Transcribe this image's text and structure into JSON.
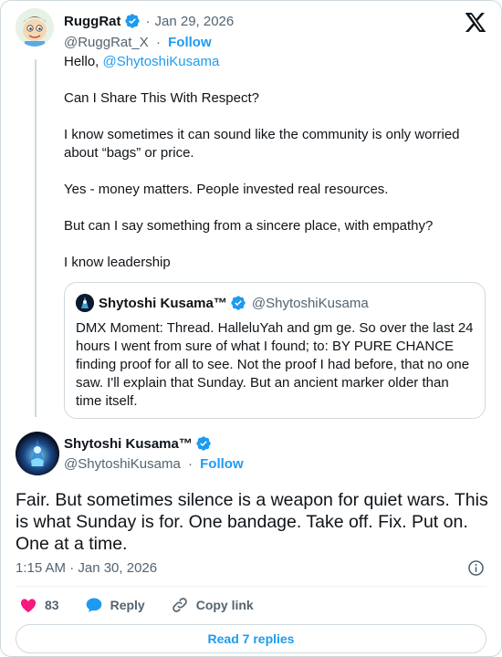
{
  "parent": {
    "name": "RuggRat",
    "handle": "@RuggRat_X",
    "sep1": "·",
    "date": "Jan 29, 2026",
    "sep2": "·",
    "follow": "Follow",
    "greeting_prefix": "Hello, ",
    "mention": "@ShytoshiKusama",
    "paragraphs": [
      "Can I Share This With Respect?",
      "I know sometimes it can sound like the community is only worried about “bags” or price.",
      "Yes - money matters. People invested real resources.",
      "But can I say something from a sincere place, with empathy?",
      "I know leadership"
    ]
  },
  "quote": {
    "name": "Shytoshi Kusama™",
    "handle": "@ShytoshiKusama",
    "text": "DMX Moment: Thread. HalleluYah and gm ge. So over the last 24 hours I went from sure of what I found; to: BY PURE CHANCE finding proof for all to see. Not the proof I had before, that no one saw. I'll explain that Sunday. But an ancient marker older than time itself."
  },
  "main": {
    "name": "Shytoshi Kusama™",
    "handle": "@ShytoshiKusama",
    "sep": "·",
    "follow": "Follow",
    "text": "Fair. But sometimes silence is a weapon for quiet wars. This is what Sunday is for. One bandage. Take off. Fix. Put on. One at a time.",
    "timestamp": "1:15 AM · Jan 30, 2026"
  },
  "actions": {
    "likes": "83",
    "reply": "Reply",
    "copy_link": "Copy link"
  },
  "read_replies": "Read 7 replies",
  "colors": {
    "accent": "#1d9bf0",
    "like": "#f91880",
    "text": "#0f1419",
    "muted": "#536471",
    "border": "#cfd9de"
  },
  "icons": [
    "verified-badge-icon",
    "x-logo-icon",
    "info-icon",
    "heart-icon",
    "reply-icon",
    "link-icon"
  ]
}
